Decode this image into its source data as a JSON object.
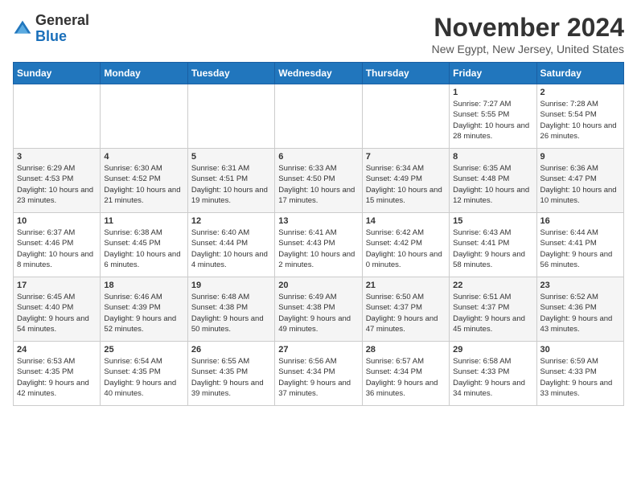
{
  "header": {
    "logo_general": "General",
    "logo_blue": "Blue",
    "month_title": "November 2024",
    "subtitle": "New Egypt, New Jersey, United States"
  },
  "weekdays": [
    "Sunday",
    "Monday",
    "Tuesday",
    "Wednesday",
    "Thursday",
    "Friday",
    "Saturday"
  ],
  "weeks": [
    [
      {
        "day": "",
        "info": ""
      },
      {
        "day": "",
        "info": ""
      },
      {
        "day": "",
        "info": ""
      },
      {
        "day": "",
        "info": ""
      },
      {
        "day": "",
        "info": ""
      },
      {
        "day": "1",
        "info": "Sunrise: 7:27 AM\nSunset: 5:55 PM\nDaylight: 10 hours and 28 minutes."
      },
      {
        "day": "2",
        "info": "Sunrise: 7:28 AM\nSunset: 5:54 PM\nDaylight: 10 hours and 26 minutes."
      }
    ],
    [
      {
        "day": "3",
        "info": "Sunrise: 6:29 AM\nSunset: 4:53 PM\nDaylight: 10 hours and 23 minutes."
      },
      {
        "day": "4",
        "info": "Sunrise: 6:30 AM\nSunset: 4:52 PM\nDaylight: 10 hours and 21 minutes."
      },
      {
        "day": "5",
        "info": "Sunrise: 6:31 AM\nSunset: 4:51 PM\nDaylight: 10 hours and 19 minutes."
      },
      {
        "day": "6",
        "info": "Sunrise: 6:33 AM\nSunset: 4:50 PM\nDaylight: 10 hours and 17 minutes."
      },
      {
        "day": "7",
        "info": "Sunrise: 6:34 AM\nSunset: 4:49 PM\nDaylight: 10 hours and 15 minutes."
      },
      {
        "day": "8",
        "info": "Sunrise: 6:35 AM\nSunset: 4:48 PM\nDaylight: 10 hours and 12 minutes."
      },
      {
        "day": "9",
        "info": "Sunrise: 6:36 AM\nSunset: 4:47 PM\nDaylight: 10 hours and 10 minutes."
      }
    ],
    [
      {
        "day": "10",
        "info": "Sunrise: 6:37 AM\nSunset: 4:46 PM\nDaylight: 10 hours and 8 minutes."
      },
      {
        "day": "11",
        "info": "Sunrise: 6:38 AM\nSunset: 4:45 PM\nDaylight: 10 hours and 6 minutes."
      },
      {
        "day": "12",
        "info": "Sunrise: 6:40 AM\nSunset: 4:44 PM\nDaylight: 10 hours and 4 minutes."
      },
      {
        "day": "13",
        "info": "Sunrise: 6:41 AM\nSunset: 4:43 PM\nDaylight: 10 hours and 2 minutes."
      },
      {
        "day": "14",
        "info": "Sunrise: 6:42 AM\nSunset: 4:42 PM\nDaylight: 10 hours and 0 minutes."
      },
      {
        "day": "15",
        "info": "Sunrise: 6:43 AM\nSunset: 4:41 PM\nDaylight: 9 hours and 58 minutes."
      },
      {
        "day": "16",
        "info": "Sunrise: 6:44 AM\nSunset: 4:41 PM\nDaylight: 9 hours and 56 minutes."
      }
    ],
    [
      {
        "day": "17",
        "info": "Sunrise: 6:45 AM\nSunset: 4:40 PM\nDaylight: 9 hours and 54 minutes."
      },
      {
        "day": "18",
        "info": "Sunrise: 6:46 AM\nSunset: 4:39 PM\nDaylight: 9 hours and 52 minutes."
      },
      {
        "day": "19",
        "info": "Sunrise: 6:48 AM\nSunset: 4:38 PM\nDaylight: 9 hours and 50 minutes."
      },
      {
        "day": "20",
        "info": "Sunrise: 6:49 AM\nSunset: 4:38 PM\nDaylight: 9 hours and 49 minutes."
      },
      {
        "day": "21",
        "info": "Sunrise: 6:50 AM\nSunset: 4:37 PM\nDaylight: 9 hours and 47 minutes."
      },
      {
        "day": "22",
        "info": "Sunrise: 6:51 AM\nSunset: 4:37 PM\nDaylight: 9 hours and 45 minutes."
      },
      {
        "day": "23",
        "info": "Sunrise: 6:52 AM\nSunset: 4:36 PM\nDaylight: 9 hours and 43 minutes."
      }
    ],
    [
      {
        "day": "24",
        "info": "Sunrise: 6:53 AM\nSunset: 4:35 PM\nDaylight: 9 hours and 42 minutes."
      },
      {
        "day": "25",
        "info": "Sunrise: 6:54 AM\nSunset: 4:35 PM\nDaylight: 9 hours and 40 minutes."
      },
      {
        "day": "26",
        "info": "Sunrise: 6:55 AM\nSunset: 4:35 PM\nDaylight: 9 hours and 39 minutes."
      },
      {
        "day": "27",
        "info": "Sunrise: 6:56 AM\nSunset: 4:34 PM\nDaylight: 9 hours and 37 minutes."
      },
      {
        "day": "28",
        "info": "Sunrise: 6:57 AM\nSunset: 4:34 PM\nDaylight: 9 hours and 36 minutes."
      },
      {
        "day": "29",
        "info": "Sunrise: 6:58 AM\nSunset: 4:33 PM\nDaylight: 9 hours and 34 minutes."
      },
      {
        "day": "30",
        "info": "Sunrise: 6:59 AM\nSunset: 4:33 PM\nDaylight: 9 hours and 33 minutes."
      }
    ]
  ]
}
